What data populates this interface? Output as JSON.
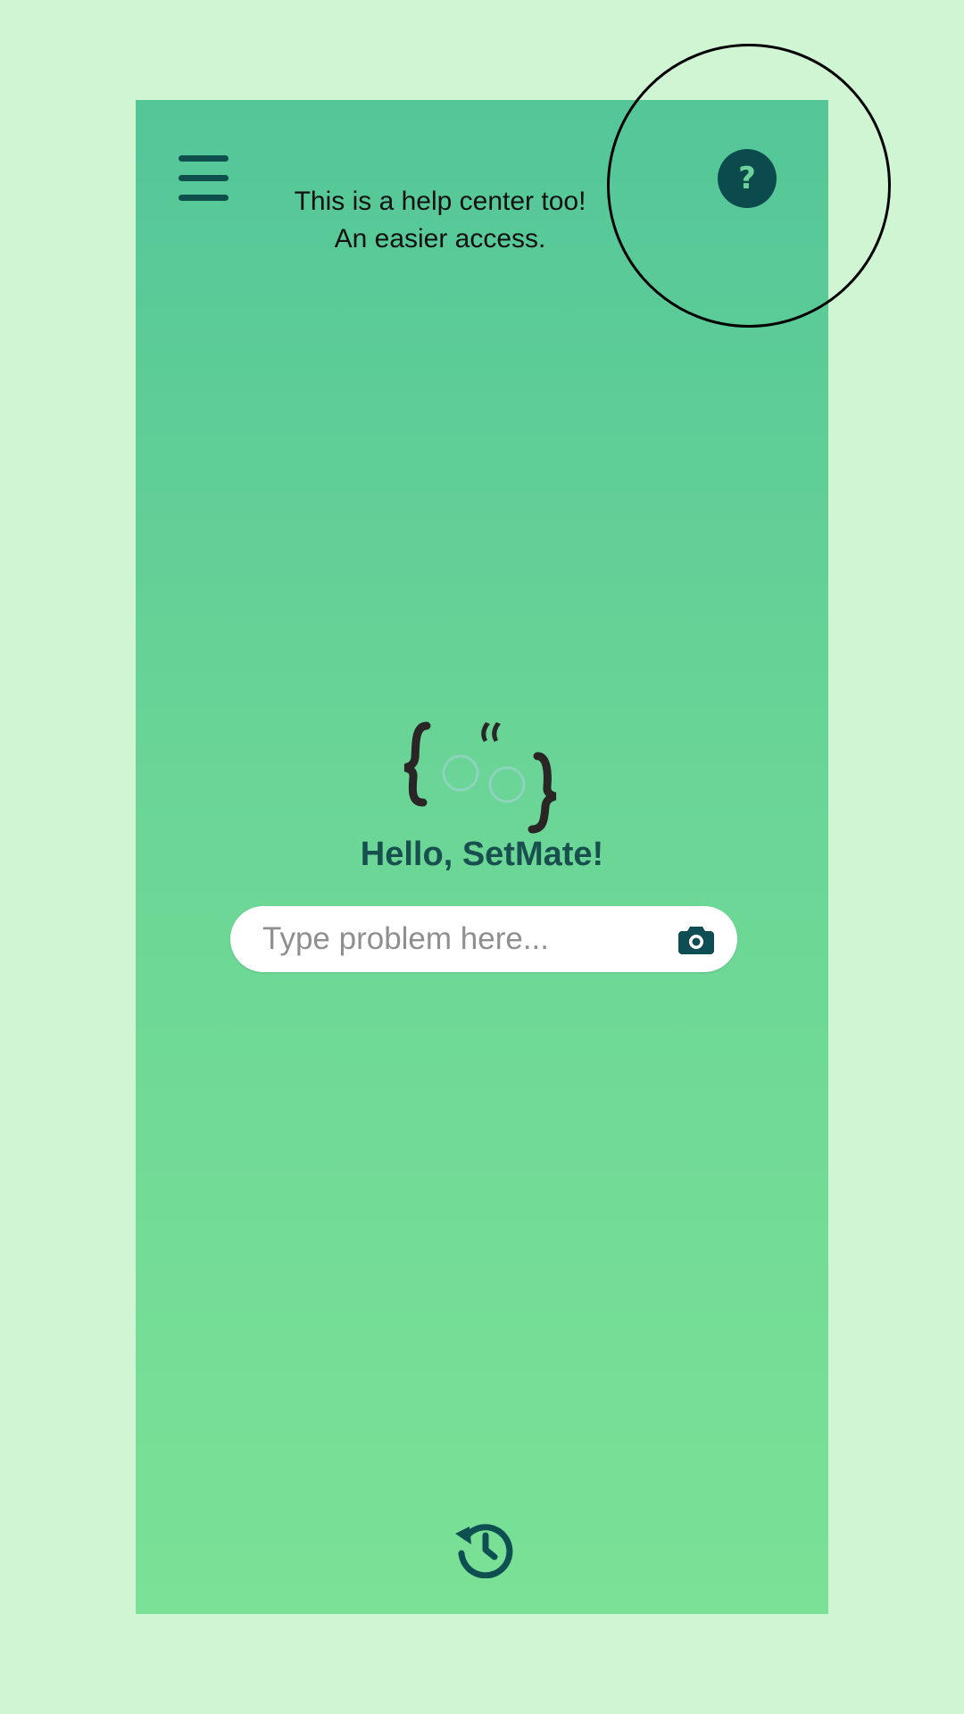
{
  "tooltip": {
    "text": "This is a help center too! An easier access."
  },
  "greeting": "Hello, SetMate!",
  "search": {
    "placeholder": "Type problem here...",
    "value": ""
  },
  "icons": {
    "menu": "hamburger-menu-icon",
    "help": "help-question-icon",
    "camera": "camera-icon",
    "history": "history-icon",
    "logo": "setmate-logo"
  },
  "colors": {
    "page_background": "#cff5d3",
    "screen_gradient_top": "#54c698",
    "screen_gradient_bottom": "#7ae196",
    "icon_dark_teal": "#0b4a4d",
    "greeting_text": "#17504e"
  }
}
